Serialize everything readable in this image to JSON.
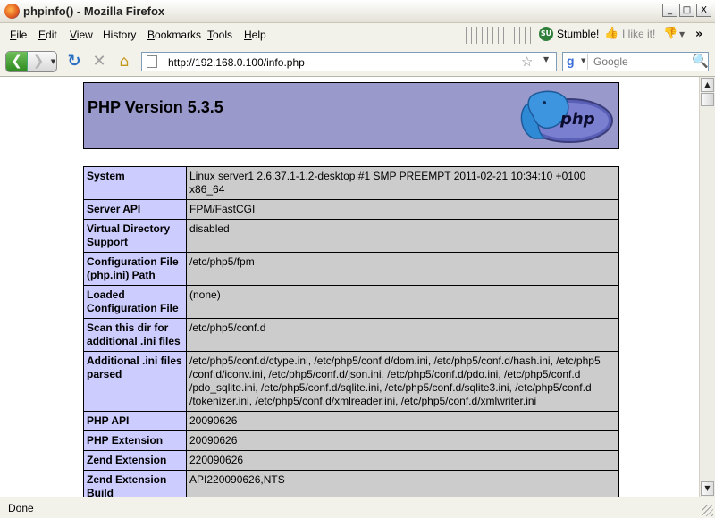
{
  "window": {
    "title": "phpinfo() - Mozilla Firefox",
    "min": "_",
    "max": "□",
    "close": "X"
  },
  "menu": [
    {
      "label": "File",
      "key": "F",
      "rest": "ile"
    },
    {
      "label": "Edit",
      "key": "E",
      "rest": "dit"
    },
    {
      "label": "View",
      "key": "V",
      "rest": "iew"
    },
    {
      "label": "History",
      "key": "",
      "rest": "History"
    },
    {
      "label": "Bookmarks",
      "key": "B",
      "rest": "ookmarks"
    },
    {
      "label": "Tools",
      "key": "T",
      "rest": "ools"
    },
    {
      "label": "Help",
      "key": "H",
      "rest": "elp"
    }
  ],
  "toolbar": {
    "stumble_label": "Stumble!",
    "stumble_icon_text": "SU",
    "likeit_label": "I like it!",
    "more": "»"
  },
  "nav": {
    "url": "http://192.168.0.100/info.php",
    "search_placeholder": "Google"
  },
  "php": {
    "title": "PHP Version 5.3.5",
    "logo_text": "php"
  },
  "rows": [
    {
      "key": "System",
      "value": "Linux server1 2.6.37.1-1.2-desktop #1 SMP PREEMPT 2011-02-21 10:34:10 +0100 x86_64"
    },
    {
      "key": "Server API",
      "value": "FPM/FastCGI"
    },
    {
      "key": "Virtual Directory Support",
      "value": "disabled"
    },
    {
      "key": "Configuration File (php.ini) Path",
      "value": "/etc/php5/fpm"
    },
    {
      "key": "Loaded Configuration File",
      "value": "(none)"
    },
    {
      "key": "Scan this dir for additional .ini files",
      "value": "/etc/php5/conf.d"
    },
    {
      "key": "Additional .ini files parsed",
      "value": "/etc/php5/conf.d/ctype.ini, /etc/php5/conf.d/dom.ini, /etc/php5/conf.d/hash.ini, /etc/php5 /conf.d/iconv.ini, /etc/php5/conf.d/json.ini, /etc/php5/conf.d/pdo.ini, /etc/php5/conf.d /pdo_sqlite.ini, /etc/php5/conf.d/sqlite.ini, /etc/php5/conf.d/sqlite3.ini, /etc/php5/conf.d /tokenizer.ini, /etc/php5/conf.d/xmlreader.ini, /etc/php5/conf.d/xmlwriter.ini"
    },
    {
      "key": "PHP API",
      "value": "20090626"
    },
    {
      "key": "PHP Extension",
      "value": "20090626"
    },
    {
      "key": "Zend Extension",
      "value": "220090626"
    },
    {
      "key": "Zend Extension Build",
      "value": "API220090626,NTS"
    }
  ],
  "status": {
    "text": "Done"
  },
  "colors": {
    "header_bg": "#9999cc",
    "key_bg": "#ccccff",
    "value_bg": "#cccccc"
  }
}
